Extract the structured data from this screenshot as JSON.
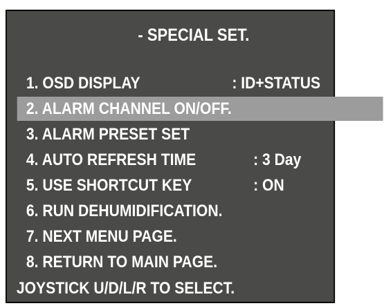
{
  "menu": {
    "title": "- SPECIAL SET.",
    "items": [
      {
        "label": "1. OSD DISPLAY",
        "value": ": ID+STATUS"
      },
      {
        "label": "2. ALARM CHANNEL ON/OFF.",
        "value": ""
      },
      {
        "label": "3. ALARM PRESET SET",
        "value": ""
      },
      {
        "label": "4. AUTO REFRESH TIME",
        "value": ": 3 Day"
      },
      {
        "label": "5. USE SHORTCUT KEY",
        "value": ": ON"
      },
      {
        "label": "6. RUN DEHUMIDIFICATION.",
        "value": ""
      },
      {
        "label": "7. NEXT MENU PAGE.",
        "value": ""
      },
      {
        "label": "8. RETURN TO MAIN PAGE.",
        "value": ""
      }
    ],
    "footer": "JOYSTICK U/D/L/R TO SELECT.",
    "selected_index": 1
  },
  "colors": {
    "background": "#4a4a48",
    "highlight": "#9c9c9c",
    "text": "#ffffff",
    "border": "#000000"
  }
}
